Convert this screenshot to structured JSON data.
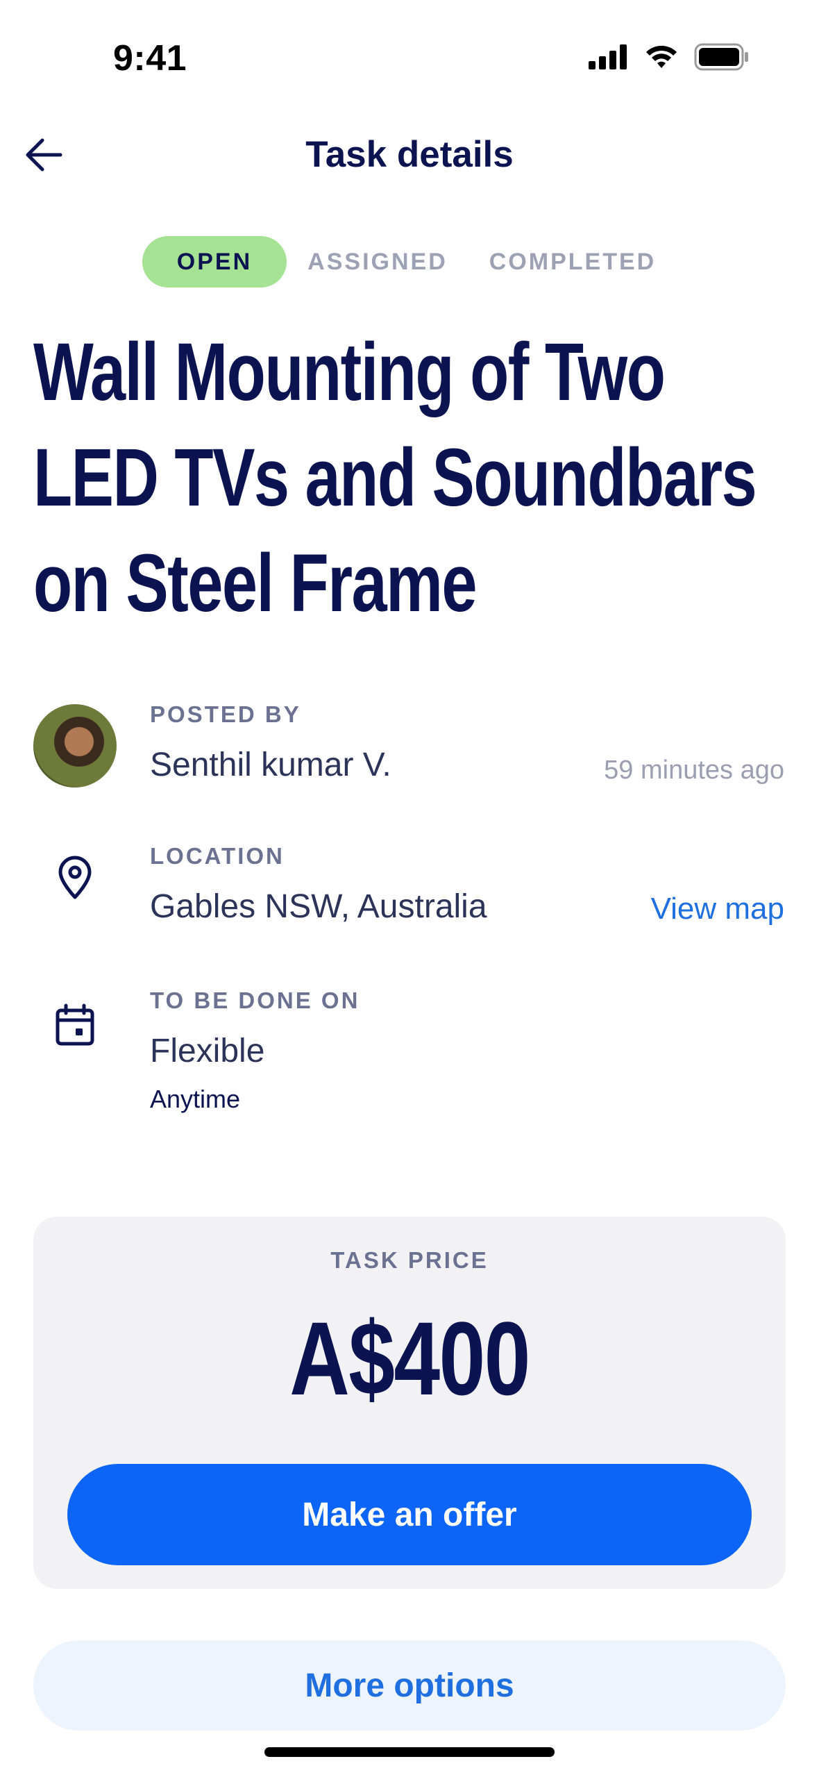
{
  "status_bar": {
    "time": "9:41"
  },
  "header": {
    "title": "Task details"
  },
  "status_tabs": [
    {
      "label": "OPEN",
      "active": true
    },
    {
      "label": "ASSIGNED",
      "active": false
    },
    {
      "label": "COMPLETED",
      "active": false
    }
  ],
  "task": {
    "title": "Wall Mounting of Two LED TVs and Soundbars on Steel Frame"
  },
  "posted_by": {
    "label": "POSTED BY",
    "name": "Senthil kumar V.",
    "time": "59 minutes ago"
  },
  "location": {
    "label": "LOCATION",
    "value": "Gables NSW, Australia",
    "link": "View map"
  },
  "schedule": {
    "label": "TO BE DONE ON",
    "value": "Flexible",
    "sub": "Anytime"
  },
  "price": {
    "label": "TASK PRICE",
    "value": "A$400",
    "cta": "Make an offer"
  },
  "more_options": "More options",
  "colors": {
    "accent": "#0d65f7",
    "navy": "#0b1450",
    "open_badge": "#a6e294",
    "link": "#1f6fe0"
  }
}
